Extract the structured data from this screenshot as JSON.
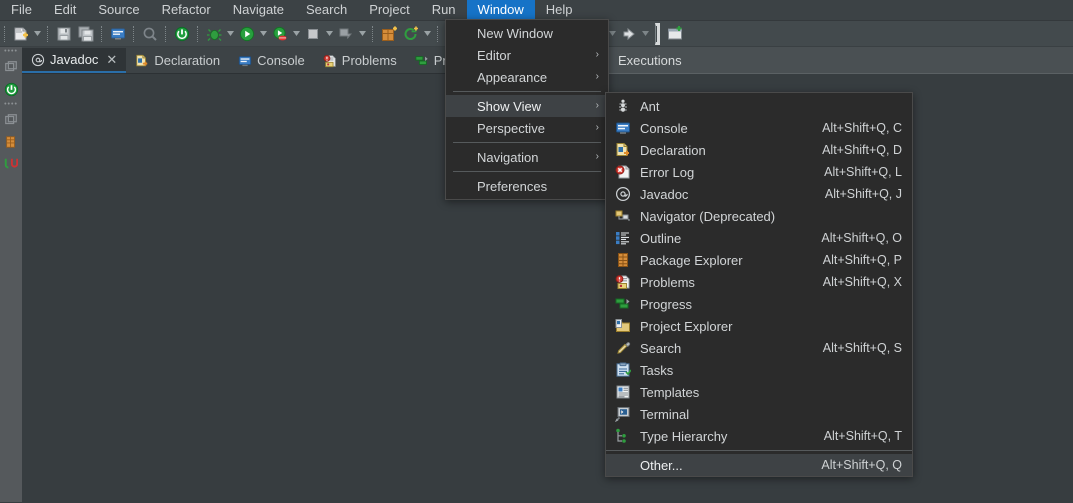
{
  "menubar": {
    "items": [
      {
        "label": "File",
        "active": false
      },
      {
        "label": "Edit",
        "active": false
      },
      {
        "label": "Source",
        "active": false
      },
      {
        "label": "Refactor",
        "active": false
      },
      {
        "label": "Navigate",
        "active": false
      },
      {
        "label": "Search",
        "active": false
      },
      {
        "label": "Project",
        "active": false
      },
      {
        "label": "Run",
        "active": false
      },
      {
        "label": "Window",
        "active": true
      },
      {
        "label": "Help",
        "active": false
      }
    ]
  },
  "toolbar": {
    "icons": [
      "new-file-icon",
      "save-icon",
      "save-all-icon",
      "console-icon",
      "search-disabled-icon",
      "terminate-icon",
      "debug-icon",
      "run-icon",
      "coverage-icon",
      "stop-icon",
      "external-tools-icon",
      "new-package-icon",
      "refresh-icon",
      "edit-icon",
      "open-type-icon",
      "open-task-icon",
      "back-icon",
      "forward-icon",
      "prev-icon",
      "next-icon",
      "new-window-icon"
    ]
  },
  "left_pane": {
    "tabs": [
      {
        "label": "Javadoc",
        "icon": "javadoc-icon",
        "active": true,
        "closable": true
      },
      {
        "label": "Declaration",
        "icon": "declaration-icon",
        "active": false,
        "closable": false
      },
      {
        "label": "Console",
        "icon": "console-icon",
        "active": false,
        "closable": false
      },
      {
        "label": "Problems",
        "icon": "problems-icon",
        "active": false,
        "closable": false
      },
      {
        "label": "Progress",
        "icon": "progress-icon",
        "active": false,
        "closable": false
      }
    ]
  },
  "right_pane": {
    "header_title": "Executions"
  },
  "window_menu": {
    "items": [
      {
        "label": "New Window",
        "submenu": false,
        "separator_after": false,
        "highlighted": false
      },
      {
        "label": "Editor",
        "submenu": true,
        "separator_after": false,
        "highlighted": false
      },
      {
        "label": "Appearance",
        "submenu": true,
        "separator_after": true,
        "highlighted": false
      },
      {
        "label": "Show View",
        "submenu": true,
        "separator_after": false,
        "highlighted": true
      },
      {
        "label": "Perspective",
        "submenu": true,
        "separator_after": true,
        "highlighted": false
      },
      {
        "label": "Navigation",
        "submenu": true,
        "separator_after": true,
        "highlighted": false
      },
      {
        "label": "Preferences",
        "submenu": false,
        "separator_after": false,
        "highlighted": false
      }
    ]
  },
  "show_view_menu": {
    "items": [
      {
        "label": "Ant",
        "accel": "",
        "icon": "ant-icon",
        "highlighted": false
      },
      {
        "label": "Console",
        "accel": "Alt+Shift+Q, C",
        "icon": "console-icon",
        "highlighted": false
      },
      {
        "label": "Declaration",
        "accel": "Alt+Shift+Q, D",
        "icon": "declaration-icon",
        "highlighted": false
      },
      {
        "label": "Error Log",
        "accel": "Alt+Shift+Q, L",
        "icon": "error-log-icon",
        "highlighted": false
      },
      {
        "label": "Javadoc",
        "accel": "Alt+Shift+Q, J",
        "icon": "javadoc-icon",
        "highlighted": false
      },
      {
        "label": "Navigator (Deprecated)",
        "accel": "",
        "icon": "navigator-icon",
        "highlighted": false
      },
      {
        "label": "Outline",
        "accel": "Alt+Shift+Q, O",
        "icon": "outline-icon",
        "highlighted": false
      },
      {
        "label": "Package Explorer",
        "accel": "Alt+Shift+Q, P",
        "icon": "package-explorer-icon",
        "highlighted": false
      },
      {
        "label": "Problems",
        "accel": "Alt+Shift+Q, X",
        "icon": "problems-icon",
        "highlighted": false
      },
      {
        "label": "Progress",
        "accel": "",
        "icon": "progress-icon",
        "highlighted": false
      },
      {
        "label": "Project Explorer",
        "accel": "",
        "icon": "project-explorer-icon",
        "highlighted": false
      },
      {
        "label": "Search",
        "accel": "Alt+Shift+Q, S",
        "icon": "search-icon",
        "highlighted": false
      },
      {
        "label": "Tasks",
        "accel": "",
        "icon": "tasks-icon",
        "highlighted": false
      },
      {
        "label": "Templates",
        "accel": "",
        "icon": "templates-icon",
        "highlighted": false
      },
      {
        "label": "Terminal",
        "accel": "",
        "icon": "terminal-icon",
        "highlighted": false
      },
      {
        "label": "Type Hierarchy",
        "accel": "Alt+Shift+Q, T",
        "icon": "type-hierarchy-icon",
        "highlighted": false
      },
      {
        "label": "Other...",
        "accel": "Alt+Shift+Q, Q",
        "icon": "none",
        "highlighted": true,
        "separator_before": true
      }
    ]
  },
  "colors": {
    "menubar_bg": "#3c4245",
    "menu_highlight": "#1673c7",
    "toolbar_bg": "#434a4d",
    "popup_bg": "#2b2b2b",
    "popup_highlight": "#3e4245",
    "workspace_bg": "#373d40",
    "rail_bg": "#55595c",
    "active_tab_underline": "#2a6ea8"
  }
}
